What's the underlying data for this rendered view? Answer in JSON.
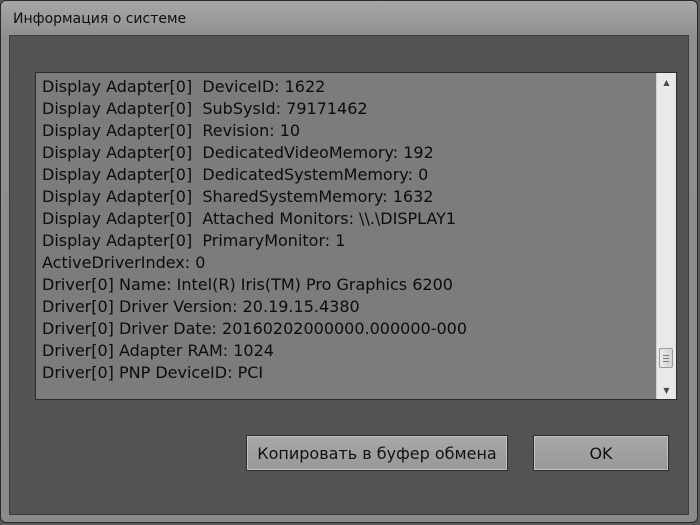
{
  "window": {
    "title": "Информация о системе"
  },
  "info": {
    "lines": [
      "Display Adapter[0]  DeviceID: 1622",
      "Display Adapter[0]  SubSysId: 79171462",
      "Display Adapter[0]  Revision: 10",
      "Display Adapter[0]  DedicatedVideoMemory: 192",
      "Display Adapter[0]  DedicatedSystemMemory: 0",
      "Display Adapter[0]  SharedSystemMemory: 1632",
      "Display Adapter[0]  Attached Monitors: \\\\.\\DISPLAY1",
      "Display Adapter[0]  PrimaryMonitor: 1",
      "ActiveDriverIndex: 0",
      "Driver[0] Name: Intel(R) Iris(TM) Pro Graphics 6200",
      "Driver[0] Driver Version: 20.19.15.4380",
      "Driver[0] Driver Date: 20160202000000.000000-000",
      "Driver[0] Adapter RAM: 1024",
      "Driver[0] PNP DeviceID: PCI"
    ]
  },
  "scrollbar": {
    "up_icon": "arrow-up-icon",
    "down_icon": "arrow-down-icon",
    "up_glyph": "▲",
    "down_glyph": "▼"
  },
  "buttons": {
    "copy_label": "Копировать в буфер обмена",
    "ok_label": "OK"
  }
}
